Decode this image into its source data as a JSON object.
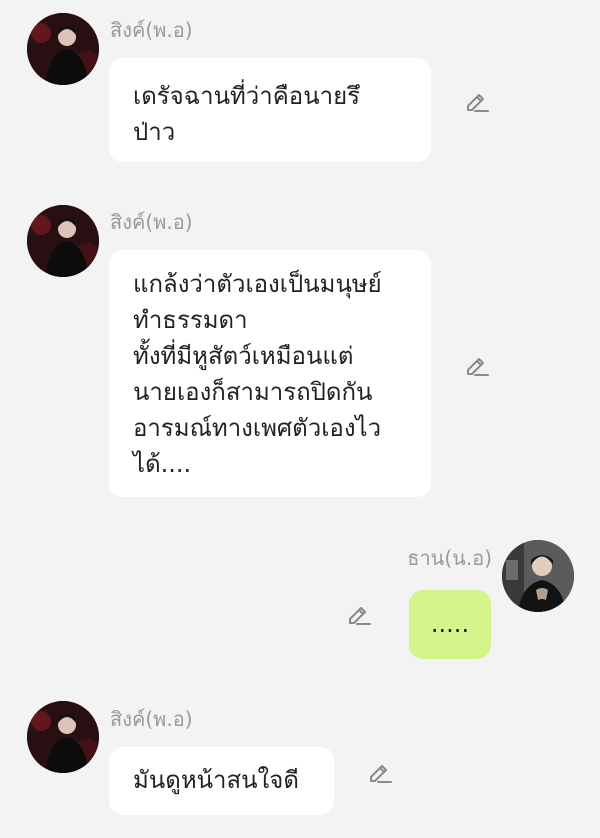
{
  "chat": {
    "messages": [
      {
        "sender": "สิงค์(พ.อ)",
        "lines": [
          "เดรัจฉานที่ว่าคือนายรึ",
          "ป่าว"
        ]
      },
      {
        "sender": "สิงค์(พ.อ)",
        "lines": [
          "แกล้งว่าตัวเองเป็นมนุษย์",
          "ทำธรรมดา",
          "ทั้งที่มีหูสัตว์เหมือนแต่",
          "นายเองก็สามารถปิดกัน",
          "อารมณ์ทางเพศตัวเองไว",
          "ได้...."
        ]
      },
      {
        "sender": "ธาน(น.อ)",
        "lines": [
          "....."
        ]
      },
      {
        "sender": "สิงค์(พ.อ)",
        "lines": [
          "มันดูหน้าสนใจดี"
        ]
      }
    ]
  },
  "icons": {
    "edit": "pencil-edit-icon",
    "avatar": "avatar-photo"
  },
  "colors": {
    "background": "#f3f3f3",
    "incoming_bubble": "#ffffff",
    "outgoing_bubble": "#d3f58c",
    "name_text": "#9a9a9a",
    "message_text": "#222222",
    "icon": "#8a8a8a"
  }
}
